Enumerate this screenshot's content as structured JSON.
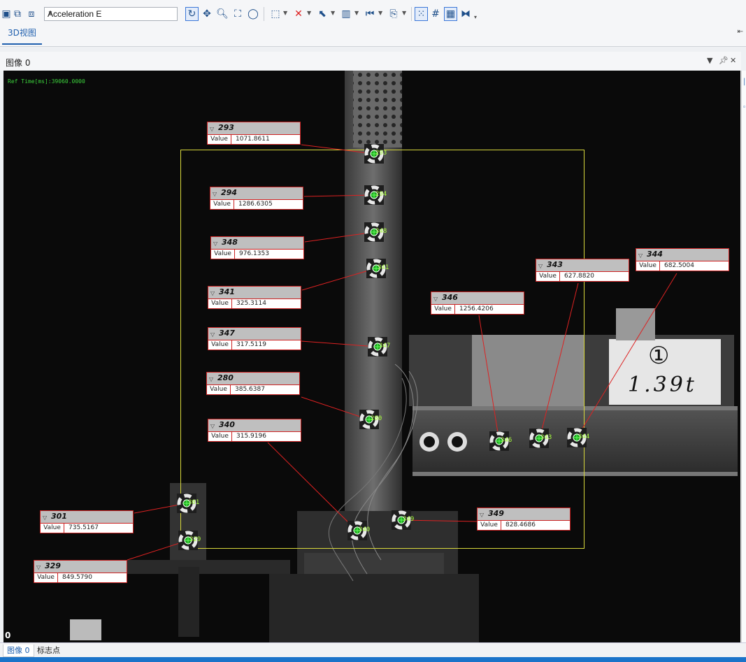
{
  "toolbar": {
    "combo_value": "Acceleration E"
  },
  "tabs": {
    "top": "3D视图",
    "bottom": [
      "图像 0",
      "标志点"
    ]
  },
  "panel": {
    "title": "图像 0"
  },
  "viewport": {
    "ref_time": "Ref Time[ms]:39060.0000",
    "frame_index": "0"
  },
  "measurements": [
    {
      "id": "293",
      "key": "Value",
      "value": "1071.8611"
    },
    {
      "id": "294",
      "key": "Value",
      "value": "1286.6305"
    },
    {
      "id": "348",
      "key": "Value",
      "value": "976.1353"
    },
    {
      "id": "341",
      "key": "Value",
      "value": "325.3114"
    },
    {
      "id": "347",
      "key": "Value",
      "value": "317.5119"
    },
    {
      "id": "280",
      "key": "Value",
      "value": "385.6387"
    },
    {
      "id": "340",
      "key": "Value",
      "value": "315.9196"
    },
    {
      "id": "301",
      "key": "Value",
      "value": "735.5167"
    },
    {
      "id": "329",
      "key": "Value",
      "value": "849.5790"
    },
    {
      "id": "346",
      "key": "Value",
      "value": "1256.4206"
    },
    {
      "id": "343",
      "key": "Value",
      "value": "627.8820"
    },
    {
      "id": "344",
      "key": "Value",
      "value": "682.5004"
    },
    {
      "id": "349",
      "key": "Value",
      "value": "828.4686"
    }
  ],
  "target_labels": [
    "293",
    "294",
    "348",
    "341",
    "347",
    "280",
    "340",
    "301",
    "329",
    "346",
    "343",
    "344",
    "349"
  ],
  "scene_text": {
    "placard_number": "①",
    "placard_load": "1.39t"
  }
}
